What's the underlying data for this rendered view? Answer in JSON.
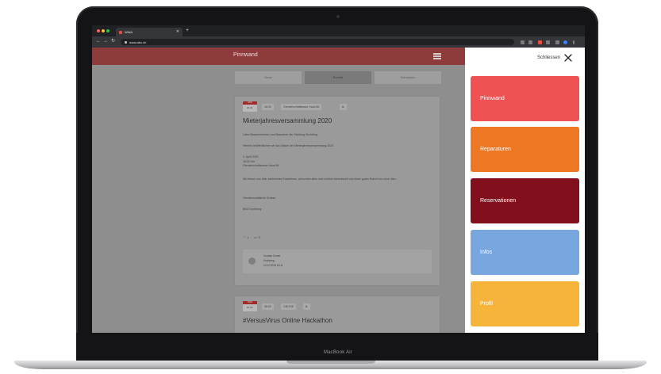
{
  "device": {
    "label": "MacBook Air"
  },
  "browser": {
    "tab_title": "WWA",
    "url": "www.abc.ch"
  },
  "app": {
    "title": "Pinnwand",
    "segments": [
      {
        "label": "Neue",
        "active": false
      },
      {
        "label": "Events",
        "active": true
      },
      {
        "label": "Marktplatz",
        "active": false
      }
    ],
    "posts": [
      {
        "date_month": "APR",
        "date_day": "02.04.",
        "time": "18:30",
        "location": "Gemeinschaftsraum Haus 58",
        "title": "Mieterjahresversammlung 2020",
        "paragraphs": [
          "Liebe Bewohnerinnen und Bewohner der Siedlung Kirchberg",
          "Hiermit veröffentlichen wir das Datum der Mieterjahresversammlung 2020.",
          "2. April 2020\n18:30 Uhr\nGemeinschaftsraum Haus 58",
          "Wir freuen uns über zahlreiches Erscheinen, wünschen allen eine schöne Adventszeit und einen guten Rutsch ins neue Jahr...",
          "Gemeinschaftliche Grüsse",
          "BBG Kirchberg"
        ],
        "likes": "1",
        "comments": "0",
        "comment": {
          "author": "Contact Center",
          "place": "Kirchberg",
          "date": "10.12.2019 16:11"
        }
      },
      {
        "date_month": "MÄR",
        "date_day": "20.03.",
        "time": "08:00",
        "location": "ONLINE",
        "title": "#VersusVirus Online Hackathon"
      }
    ]
  },
  "side_menu": {
    "close_label": "Schliessen",
    "items": [
      {
        "label": "Pinnwand",
        "color": "#ee5253"
      },
      {
        "label": "Reparaturen",
        "color": "#ed7722"
      },
      {
        "label": "Reservationen",
        "color": "#820f1c"
      },
      {
        "label": "Infos",
        "color": "#78a6df"
      },
      {
        "label": "Profil",
        "color": "#f7b43a"
      }
    ]
  }
}
